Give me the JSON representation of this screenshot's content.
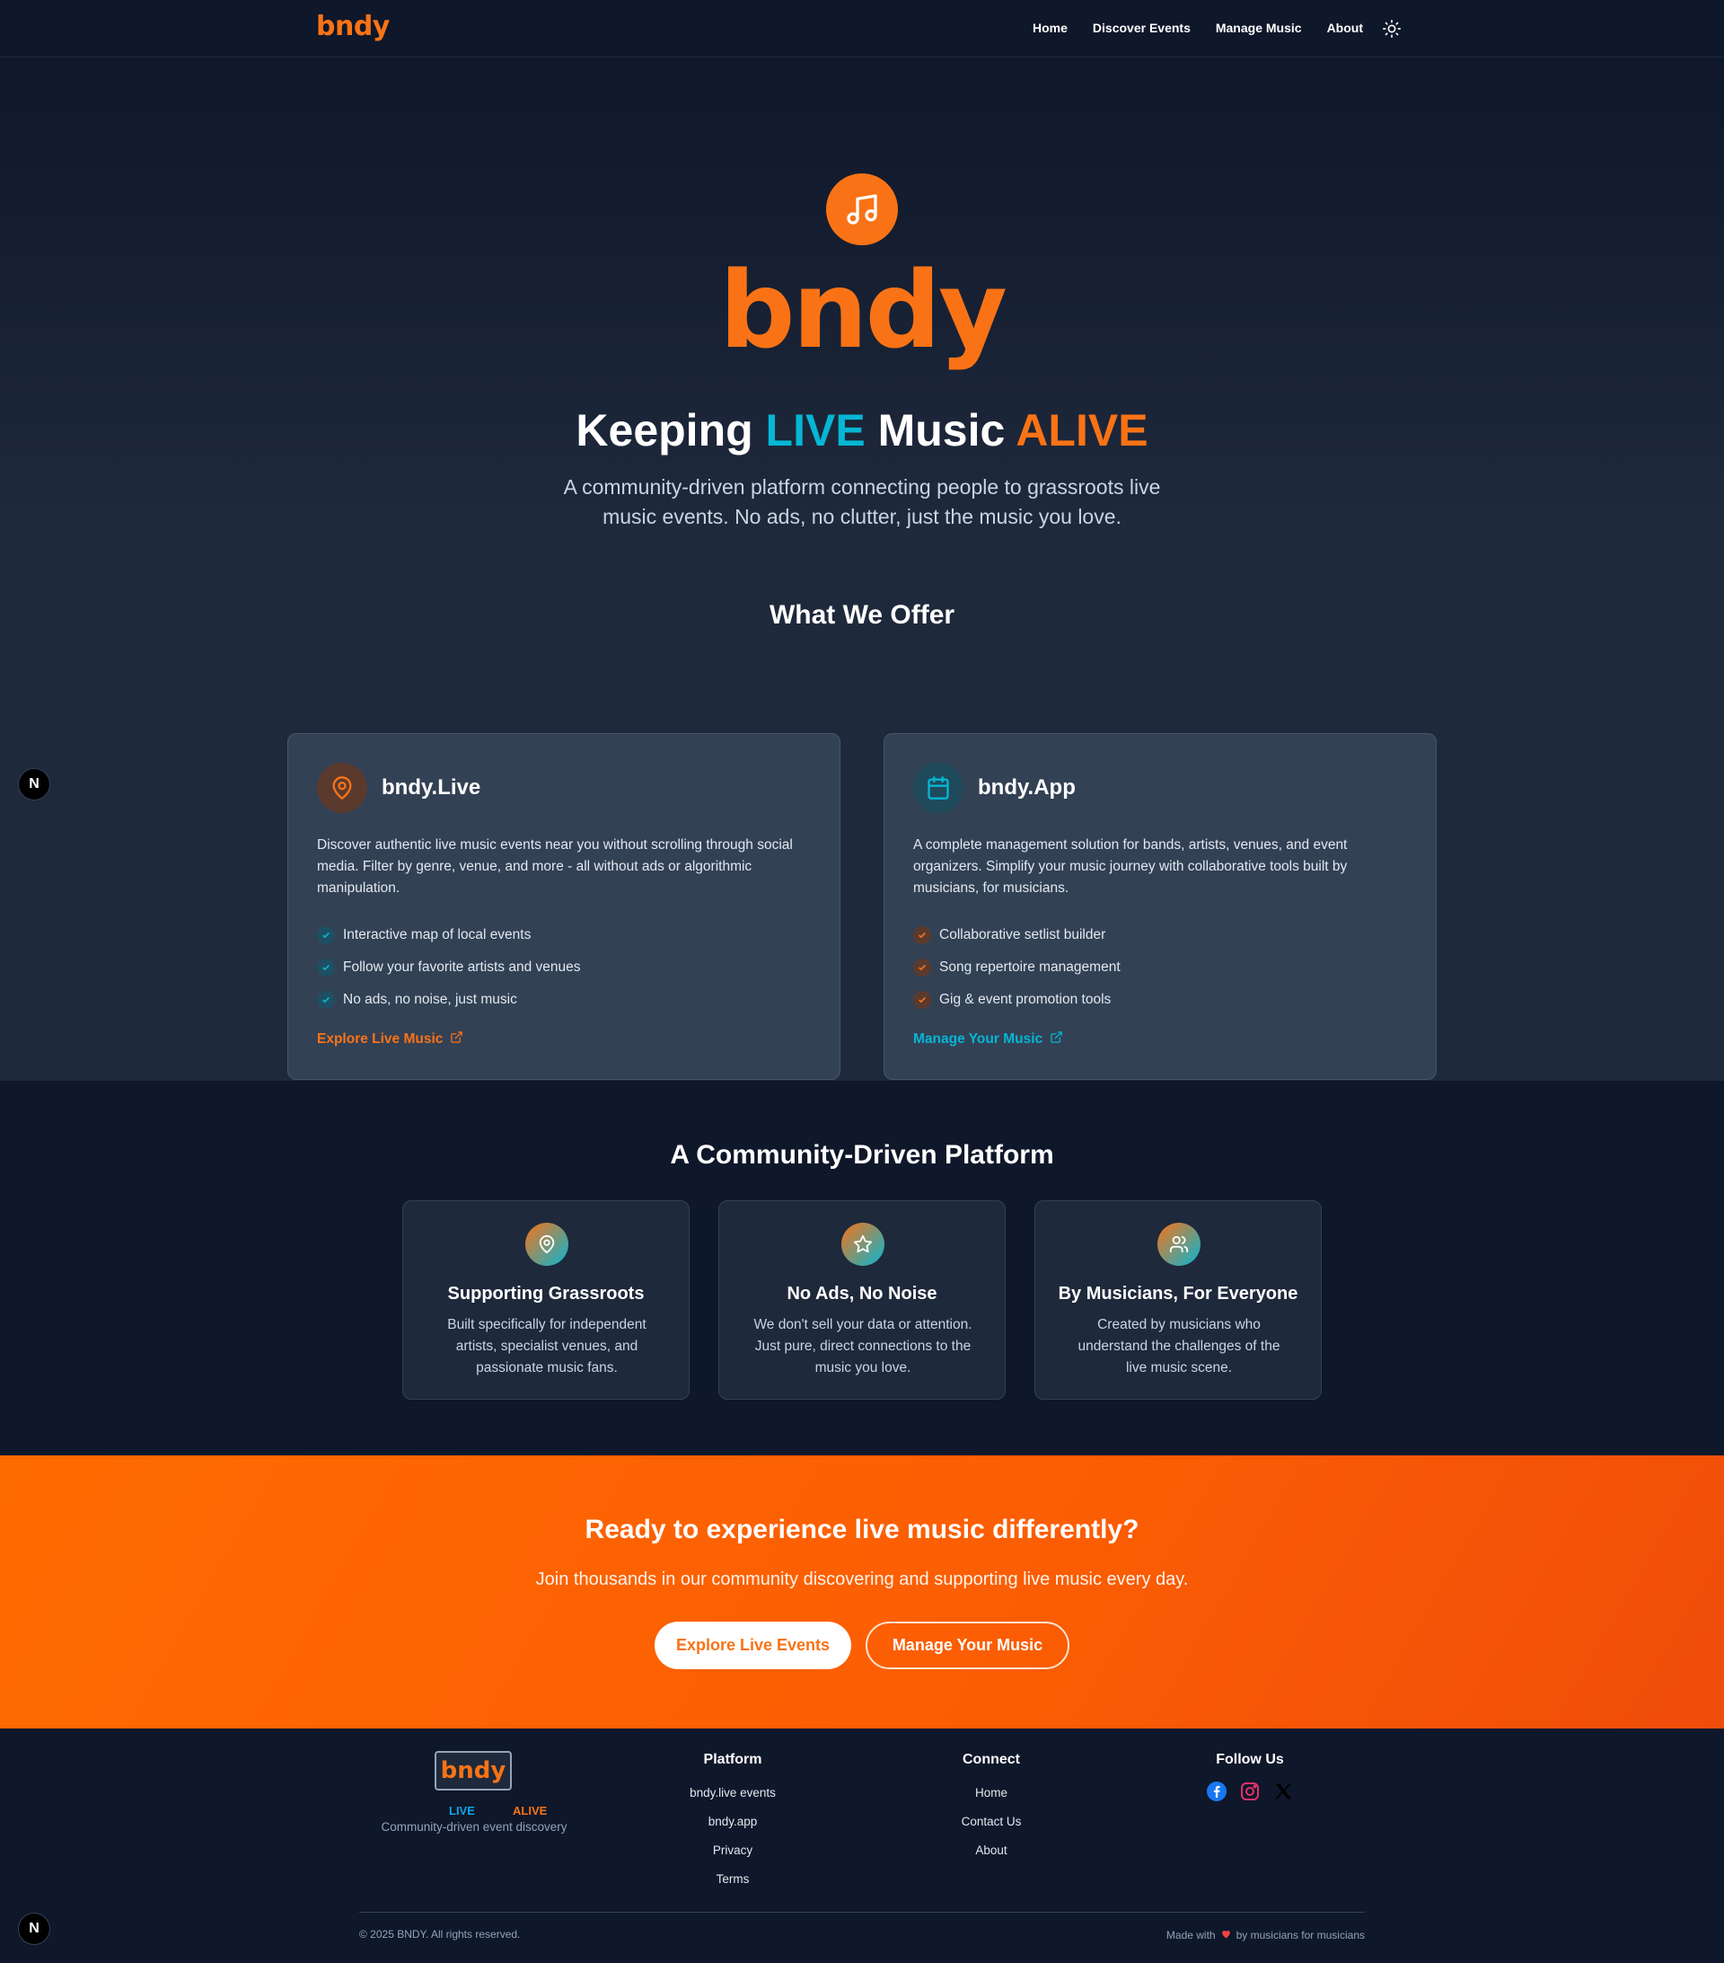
{
  "nav": {
    "logo": "bndy",
    "links": [
      "Home",
      "Discover Events",
      "Manage Music",
      "About"
    ],
    "theme_icon": "sun-icon"
  },
  "hero": {
    "icon": "music-note-icon",
    "wordmark": "bndy",
    "title_parts": [
      "Keeping ",
      "LIVE",
      " Music ",
      "ALIVE"
    ],
    "subtitle": "A community-driven platform connecting people to grassroots live music events. No ads, no clutter, just the music you love."
  },
  "offer": {
    "title": "What We Offer",
    "cards": [
      {
        "icon": "map-pin-icon",
        "title": "bndy.Live",
        "description": "Discover authentic live music events near you without scrolling through social media. Filter by genre, venue, and more - all without ads or algorithmic manipulation.",
        "features": [
          "Interactive map of local events",
          "Follow your favorite artists and venues",
          "No ads, no noise, just music"
        ],
        "link": "Explore Live Music",
        "accent": "#f97316",
        "check_color": "#06b6d4"
      },
      {
        "icon": "calendar-icon",
        "title": "bndy.App",
        "description": "A complete management solution for bands, artists, venues, and event organizers. Simplify your music journey with collaborative tools built by musicians, for musicians.",
        "features": [
          "Collaborative setlist builder",
          "Song repertoire management",
          "Gig & event promotion tools"
        ],
        "link": "Manage Your Music",
        "accent": "#06b6d4",
        "check_color": "#f97316"
      }
    ]
  },
  "community": {
    "title": "A Community-Driven Platform",
    "cards": [
      {
        "icon": "map-pin-icon",
        "title": "Supporting Grassroots",
        "description": "Built specifically for independent artists, specialist venues, and passionate music fans."
      },
      {
        "icon": "star-icon",
        "title": "No Ads, No Noise",
        "description": "We don't sell your data or attention. Just pure, direct connections to the music you love."
      },
      {
        "icon": "users-icon",
        "title": "By Musicians, For Everyone",
        "description": "Created by musicians who understand the challenges of the live music scene."
      }
    ]
  },
  "cta": {
    "title": "Ready to experience live music differently?",
    "subtitle": "Join thousands in our community discovering and supporting live music every day.",
    "primary_button": "Explore Live Events",
    "secondary_button": "Manage Your Music"
  },
  "footer": {
    "logo": "bndy",
    "live": "LIVE",
    "alive": "ALIVE",
    "tagline": "Community-driven event discovery",
    "platform": {
      "title": "Platform",
      "links": [
        "bndy.live events",
        "bndy.app",
        "Privacy",
        "Terms"
      ]
    },
    "connect": {
      "title": "Connect",
      "links": [
        "Home",
        "Contact Us",
        "About"
      ]
    },
    "follow": {
      "title": "Follow Us",
      "icons": [
        "facebook-icon",
        "instagram-icon",
        "x-icon"
      ]
    },
    "copyright": "© 2025 BNDY. All rights reserved.",
    "made_prefix": "Made with",
    "made_suffix": "by musicians for musicians"
  },
  "dev_badge": "N",
  "colors": {
    "orange": "#f97316",
    "cyan": "#06b6d4",
    "navy": "#0f172a",
    "slate": "#1e293b"
  }
}
